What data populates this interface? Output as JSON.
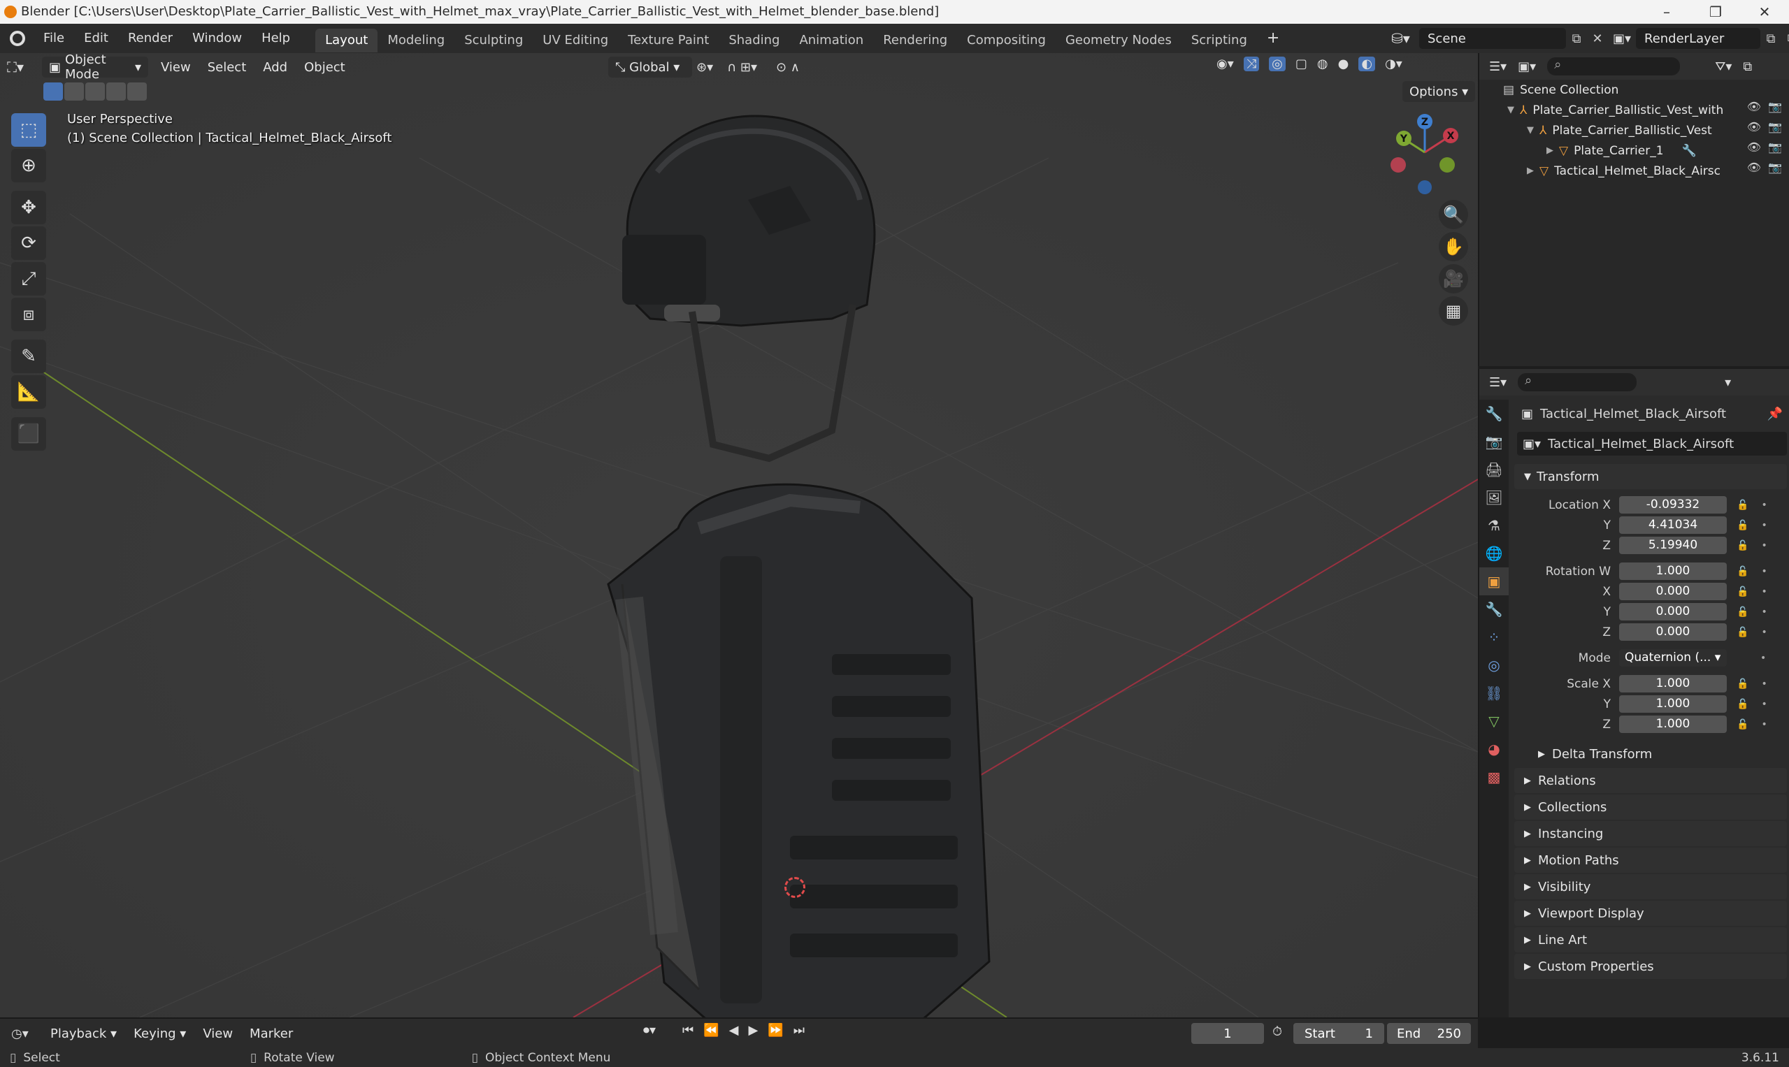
{
  "window": {
    "title": "Blender [C:\\Users\\User\\Desktop\\Plate_Carrier_Ballistic_Vest_with_Helmet_max_vray\\Plate_Carrier_Ballistic_Vest_with_Helmet_blender_base.blend]",
    "minimize": "–",
    "maximize": "❐",
    "close": "✕"
  },
  "menu": {
    "items": [
      "File",
      "Edit",
      "Render",
      "Window",
      "Help"
    ],
    "workspaces": [
      "Layout",
      "Modeling",
      "Sculpting",
      "UV Editing",
      "Texture Paint",
      "Shading",
      "Animation",
      "Rendering",
      "Compositing",
      "Geometry Nodes",
      "Scripting"
    ],
    "active_workspace": "Layout",
    "add_workspace": "+",
    "scene": "Scene",
    "render_layer": "RenderLayer"
  },
  "viewport": {
    "mode": "Object Mode",
    "menus": [
      "View",
      "Select",
      "Add",
      "Object"
    ],
    "orientation": "Global",
    "options": "Options",
    "perspective": "User Perspective",
    "context": "(1) Scene Collection | Tactical_Helmet_Black_Airsoft",
    "gizmo": {
      "x": "X",
      "y": "Y",
      "z": "Z"
    }
  },
  "outliner": {
    "root": "Scene Collection",
    "items": [
      {
        "label": "Plate_Carrier_Ballistic_Vest_with",
        "depth": 1
      },
      {
        "label": "Plate_Carrier_Ballistic_Vest",
        "depth": 2
      },
      {
        "label": "Plate_Carrier_1",
        "depth": 3
      },
      {
        "label": "Tactical_Helmet_Black_Airsc",
        "depth": 2
      }
    ]
  },
  "properties": {
    "object_name": "Tactical_Helmet_Black_Airsoft",
    "data_name": "Tactical_Helmet_Black_Airsoft",
    "transform": {
      "title": "Transform",
      "location_label": "Location X",
      "location": [
        "-0.09332",
        "4.41034",
        "5.19940"
      ],
      "rotation_label": "Rotation W",
      "rotation": [
        "1.000",
        "0.000",
        "0.000",
        "0.000"
      ],
      "mode_label": "Mode",
      "mode": "Quaternion (...",
      "scale_label": "Scale X",
      "scale": [
        "1.000",
        "1.000",
        "1.000"
      ],
      "y": "Y",
      "z": "Z",
      "x": "X"
    },
    "delta": "Delta Transform",
    "panels": [
      "Relations",
      "Collections",
      "Instancing",
      "Motion Paths",
      "Visibility",
      "Viewport Display",
      "Line Art",
      "Custom Properties"
    ]
  },
  "timeline": {
    "menus": [
      "Playback",
      "Keying",
      "View",
      "Marker"
    ],
    "current_frame": "1",
    "start_label": "Start",
    "start": "1",
    "end_label": "End",
    "end": "250"
  },
  "status": {
    "select": "Select",
    "rotate": "Rotate View",
    "context_menu": "Object Context Menu",
    "version": "3.6.11"
  },
  "colors": {
    "accent": "#4772b3",
    "x_axis": "#c43c4c",
    "y_axis": "#7fa832",
    "z_axis": "#3f7fcf"
  }
}
